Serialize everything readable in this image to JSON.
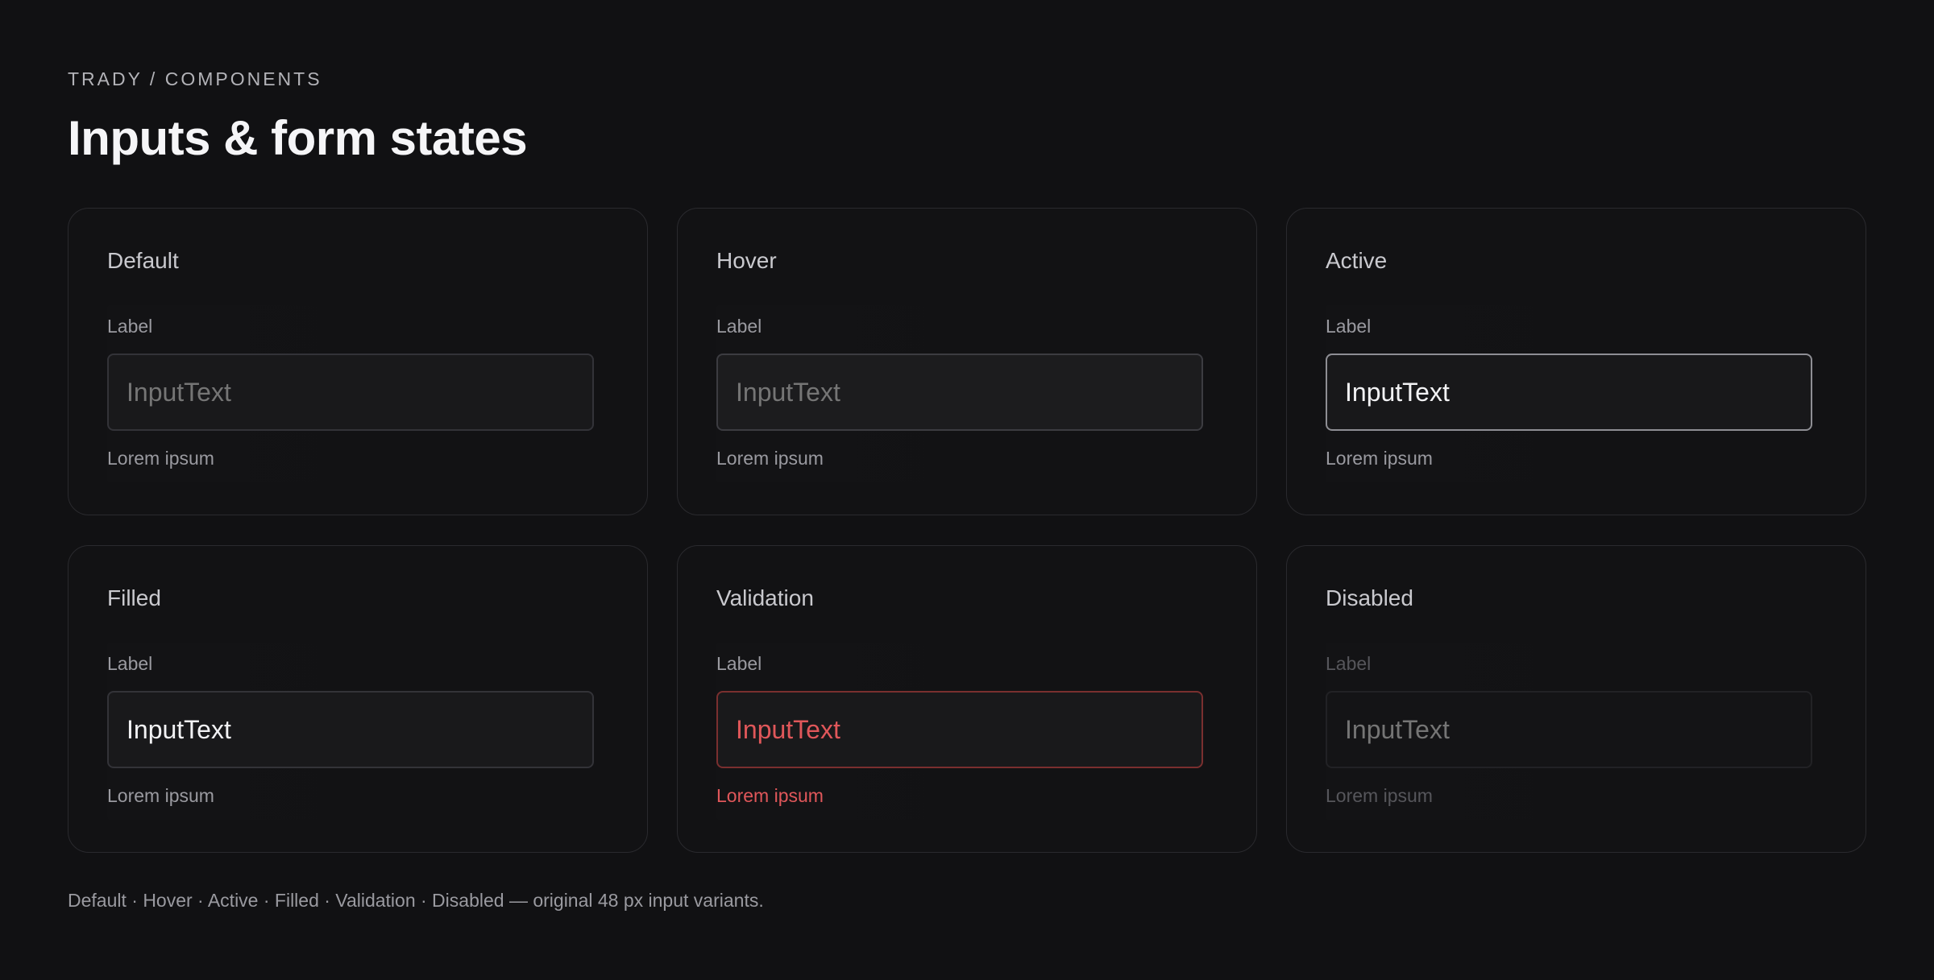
{
  "header": {
    "breadcrumb": "TRADY / COMPONENTS",
    "title": "Inputs & form states"
  },
  "states": [
    {
      "title": "Default",
      "label": "Label",
      "value": "InputText",
      "helper": "Lorem ipsum"
    },
    {
      "title": "Hover",
      "label": "Label",
      "value": "InputText",
      "helper": "Lorem ipsum"
    },
    {
      "title": "Active",
      "label": "Label",
      "value": "InputText",
      "helper": "Lorem ipsum"
    },
    {
      "title": "Filled",
      "label": "Label",
      "value": "InputText",
      "helper": "Lorem ipsum"
    },
    {
      "title": "Validation",
      "label": "Label",
      "value": "InputText",
      "helper": "Lorem ipsum"
    },
    {
      "title": "Disabled",
      "label": "Label",
      "value": "InputText",
      "helper": "Lorem ipsum"
    }
  ],
  "footnote": "Default · Hover · Active · Filled · Validation · Disabled — original 48 px input variants.",
  "colors": {
    "background": "#111113",
    "card_border": "#2a2a2e",
    "active_border": "#8e8e94",
    "error": "#e0575a",
    "error_border": "#7a2f2f"
  }
}
